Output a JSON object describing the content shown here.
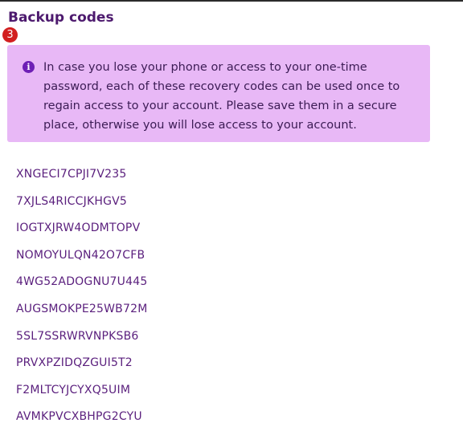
{
  "section": {
    "title": "Backup codes",
    "step_number": "3"
  },
  "info": {
    "icon": "info-icon",
    "message": "In case you lose your phone or access to your one-time password, each of these recovery codes can be used once to regain access to your account. Please save them in a secure place, otherwise you will lose access to your account."
  },
  "codes": [
    "XNGECI7CPJI7V235",
    "7XJLS4RICCJKHGV5",
    "IOGTXJRW4ODMTOPV",
    "NOMOYULQN42O7CFB",
    "4WG52ADOGNU7U445",
    "AUGSMOKPE25WB72M",
    "5SL7SSRWRVNPKSB6",
    "PRVXPZIDQZGUI5T2",
    "F2MLTCYJCYXQ5UIM",
    "AVMKPVCXBHPG2CYU"
  ],
  "colors": {
    "title": "#4d1a6e",
    "info_background": "#e8b8f6",
    "info_icon": "#6e1fb5",
    "code_text": "#5a1f7d",
    "step_badge": "#d21f1f"
  }
}
